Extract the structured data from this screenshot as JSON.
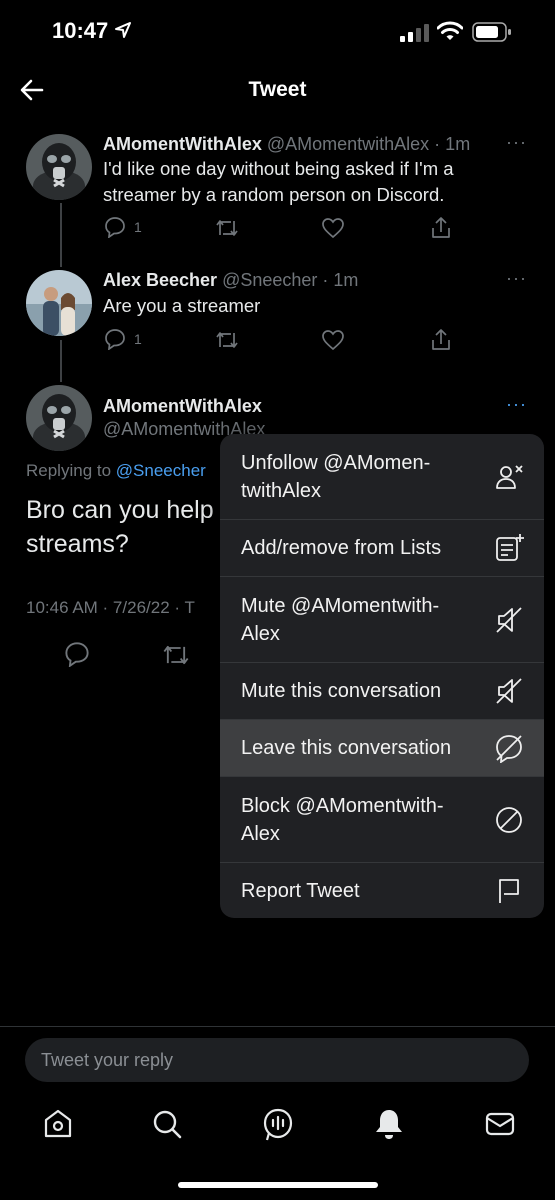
{
  "status_bar": {
    "time": "10:47"
  },
  "header": {
    "title": "Tweet"
  },
  "tweets": [
    {
      "name": "AMomentWithAlex",
      "handle": "@AMomentwithAlex · 1m",
      "text_lines": [
        "I'd like one day without being asked if I'm a",
        "streamer by a random person on Discord."
      ],
      "reply_count": "1"
    },
    {
      "name": "Alex Beecher",
      "handle": "@Sneecher · 1m",
      "text_lines": [
        "Are you a streamer"
      ],
      "reply_count": "1"
    }
  ],
  "focus_tweet": {
    "name": "AMomentWithAlex",
    "handle": "@AMomentwithAlex",
    "replying_prefix": "Replying to ",
    "replying_to": "@Sneecher",
    "text_lines": [
      "Bro can you help",
      "streams?"
    ],
    "timestamp": "10:46 AM · 7/26/22 · T"
  },
  "menu": {
    "items": [
      {
        "label": "Unfollow @AMomen-twithAlex",
        "icon": "unfollow-icon"
      },
      {
        "label": "Add/remove from Lists",
        "icon": "lists-icon"
      },
      {
        "label": "Mute @AMomentwith-Alex",
        "icon": "mute-icon"
      },
      {
        "label": "Mute this conversation",
        "icon": "mute-icon"
      },
      {
        "label": "Leave this conversation",
        "icon": "leave-icon",
        "highlighted": true
      },
      {
        "label": "Block @AMomentwith-Alex",
        "icon": "block-icon"
      },
      {
        "label": "Report Tweet",
        "icon": "flag-icon"
      }
    ]
  },
  "reply_bar": {
    "placeholder": "Tweet your reply"
  },
  "bottom_nav": [
    "home-icon",
    "search-icon",
    "spaces-icon",
    "notifications-icon",
    "messages-icon"
  ],
  "colors": {
    "background": "#000000",
    "link": "#4a9ff0",
    "menu_bg": "#202124",
    "menu_highlight": "#3e3f41"
  }
}
